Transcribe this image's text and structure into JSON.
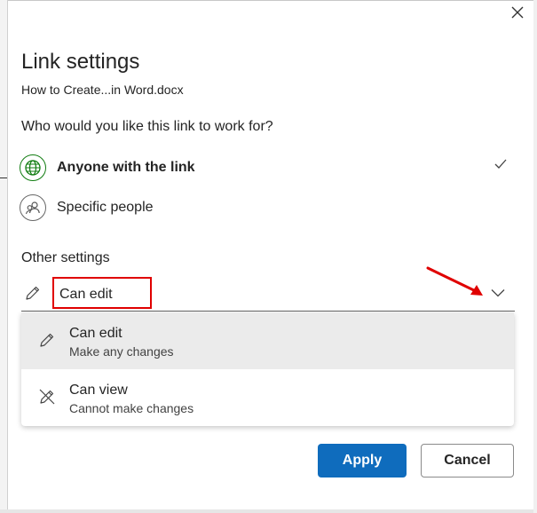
{
  "dialog": {
    "title": "Link settings",
    "filename": "How to Create...in Word.docx",
    "question": "Who would you like this link to work for?",
    "close_icon": "close-icon"
  },
  "audience_options": [
    {
      "label": "Anyone with the link",
      "icon": "globe-icon",
      "selected": true
    },
    {
      "label": "Specific people",
      "icon": "people-icon",
      "selected": false
    }
  ],
  "other_settings": {
    "heading": "Other settings",
    "permission_value": "Can edit",
    "permission_icon": "pencil-icon",
    "dropdown_icon": "chevron-down-icon"
  },
  "permission_menu": [
    {
      "label": "Can edit",
      "description": "Make any changes",
      "icon": "pencil-icon",
      "highlighted": true
    },
    {
      "label": "Can view",
      "description": "Cannot make changes",
      "icon": "pencil-off-icon",
      "highlighted": false
    }
  ],
  "buttons": {
    "apply": "Apply",
    "cancel": "Cancel"
  },
  "colors": {
    "accent": "#0f6cbd",
    "highlight_box": "#e00000",
    "globe_green": "#107c10",
    "menu_selected_bg": "#ebebeb"
  }
}
